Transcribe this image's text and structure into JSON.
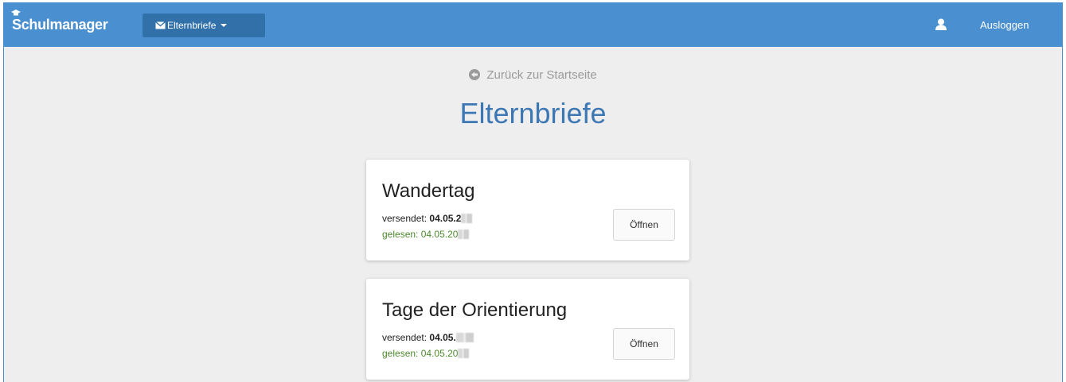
{
  "navbar": {
    "brand": "Schulmanager",
    "dropdown_label": "Elternbriefe",
    "logout_label": "Ausloggen",
    "color": "#4a8fd0"
  },
  "main": {
    "back_link": "Zurück zur Startseite",
    "page_title": "Elternbriefe",
    "letters": [
      {
        "title": "Wandertag",
        "sent_label": "versendet:",
        "sent_value": "04.05.2",
        "read_label": "gelesen:",
        "read_value": "04.05.20",
        "open_label": "Öffnen"
      },
      {
        "title": "Tage der Orientierung",
        "sent_label": "versendet:",
        "sent_value": "04.05.",
        "read_label": "gelesen:",
        "read_value": "04.05.20",
        "open_label": "Öffnen"
      }
    ]
  },
  "icons": {
    "brand": "graduation-cap-icon",
    "dropdown": "envelope-icon",
    "user": "user-icon",
    "back": "arrow-circle-left-icon"
  }
}
